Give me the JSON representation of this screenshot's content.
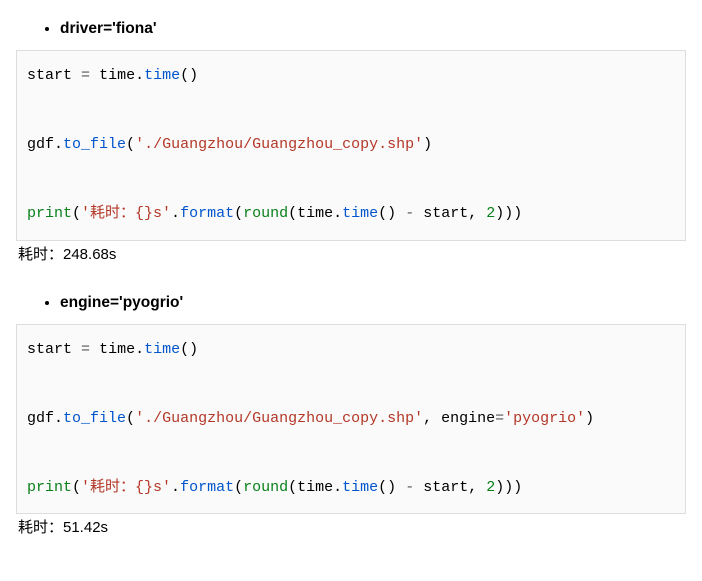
{
  "section1": {
    "heading": "driver='fiona'",
    "code_raw": "start = time.time()\n\ngdf.to_file('./Guangzhou/Guangzhou_copy.shp')\n\nprint('耗时：{}s'.format(round(time.time() - start, 2)))",
    "output": "耗时：248.68s"
  },
  "section2": {
    "heading": "engine='pyogrio'",
    "code_raw": "start = time.time()\n\ngdf.to_file('./Guangzhou/Guangzhou_copy.shp', engine='pyogrio')\n\nprint('耗时：{}s'.format(round(time.time() - start, 2)))",
    "output": "耗时：51.42s"
  }
}
